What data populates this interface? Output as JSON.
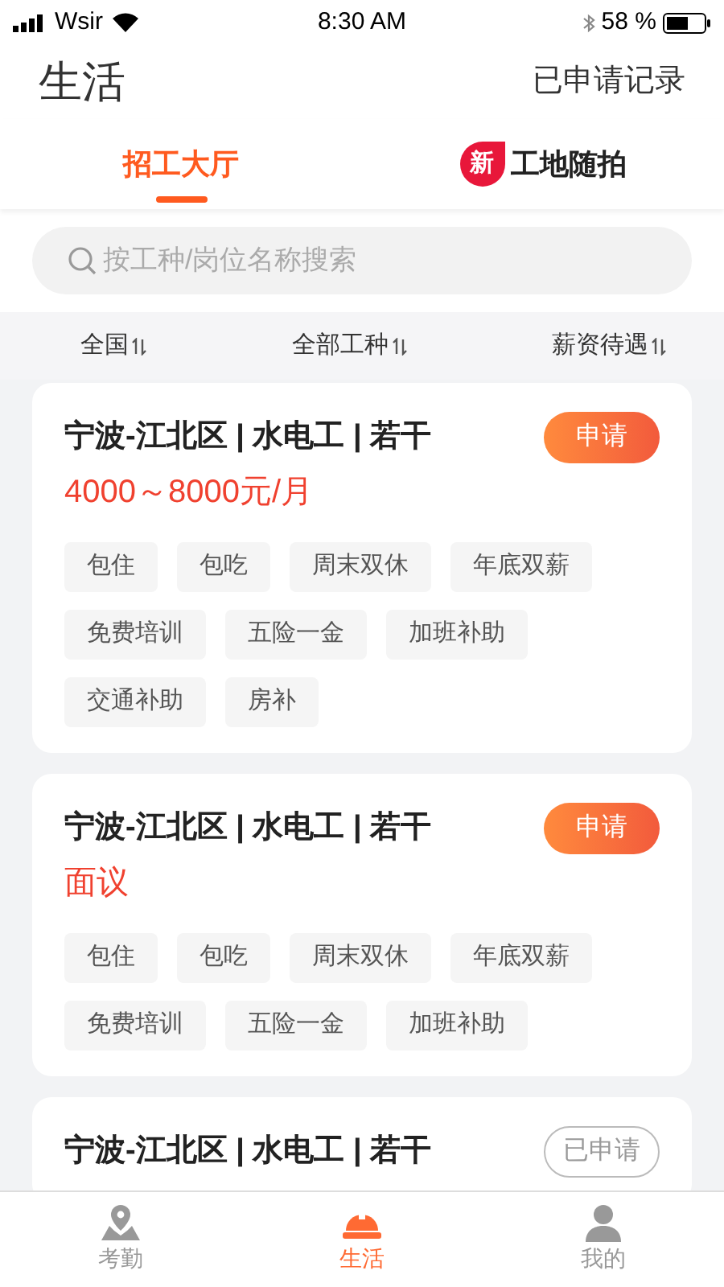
{
  "status_bar": {
    "carrier": "Wsir",
    "time": "8:30 AM",
    "battery": "58 %"
  },
  "header": {
    "title": "生活",
    "action": "已申请记录"
  },
  "tabs": [
    {
      "label": "招工大厅",
      "selected": true
    },
    {
      "label": "工地随拍",
      "selected": false,
      "badge": "新"
    }
  ],
  "search": {
    "placeholder": "按工种/岗位名称搜索"
  },
  "filters": [
    {
      "label": "全国"
    },
    {
      "label": "全部工种"
    },
    {
      "label": "薪资待遇"
    }
  ],
  "jobs": [
    {
      "title": "宁波-江北区 | 水电工 | 若干",
      "salary": "4000～8000元/月",
      "button": "申请",
      "applied": false,
      "tags": [
        "包住",
        "包吃",
        "周末双休",
        "年底双薪",
        "免费培训",
        "五险一金",
        "加班补助",
        "交通补助",
        "房补"
      ]
    },
    {
      "title": "宁波-江北区 | 水电工 | 若干",
      "salary": "面议",
      "button": "申请",
      "applied": false,
      "tags": [
        "包住",
        "包吃",
        "周末双休",
        "年底双薪",
        "免费培训",
        "五险一金",
        "加班补助"
      ]
    },
    {
      "title": "宁波-江北区 | 水电工 | 若干",
      "button": "已申请",
      "applied": true
    }
  ],
  "bottom_nav": [
    {
      "label": "考勤",
      "selected": false
    },
    {
      "label": "生活",
      "selected": true
    },
    {
      "label": "我的",
      "selected": false
    }
  ]
}
